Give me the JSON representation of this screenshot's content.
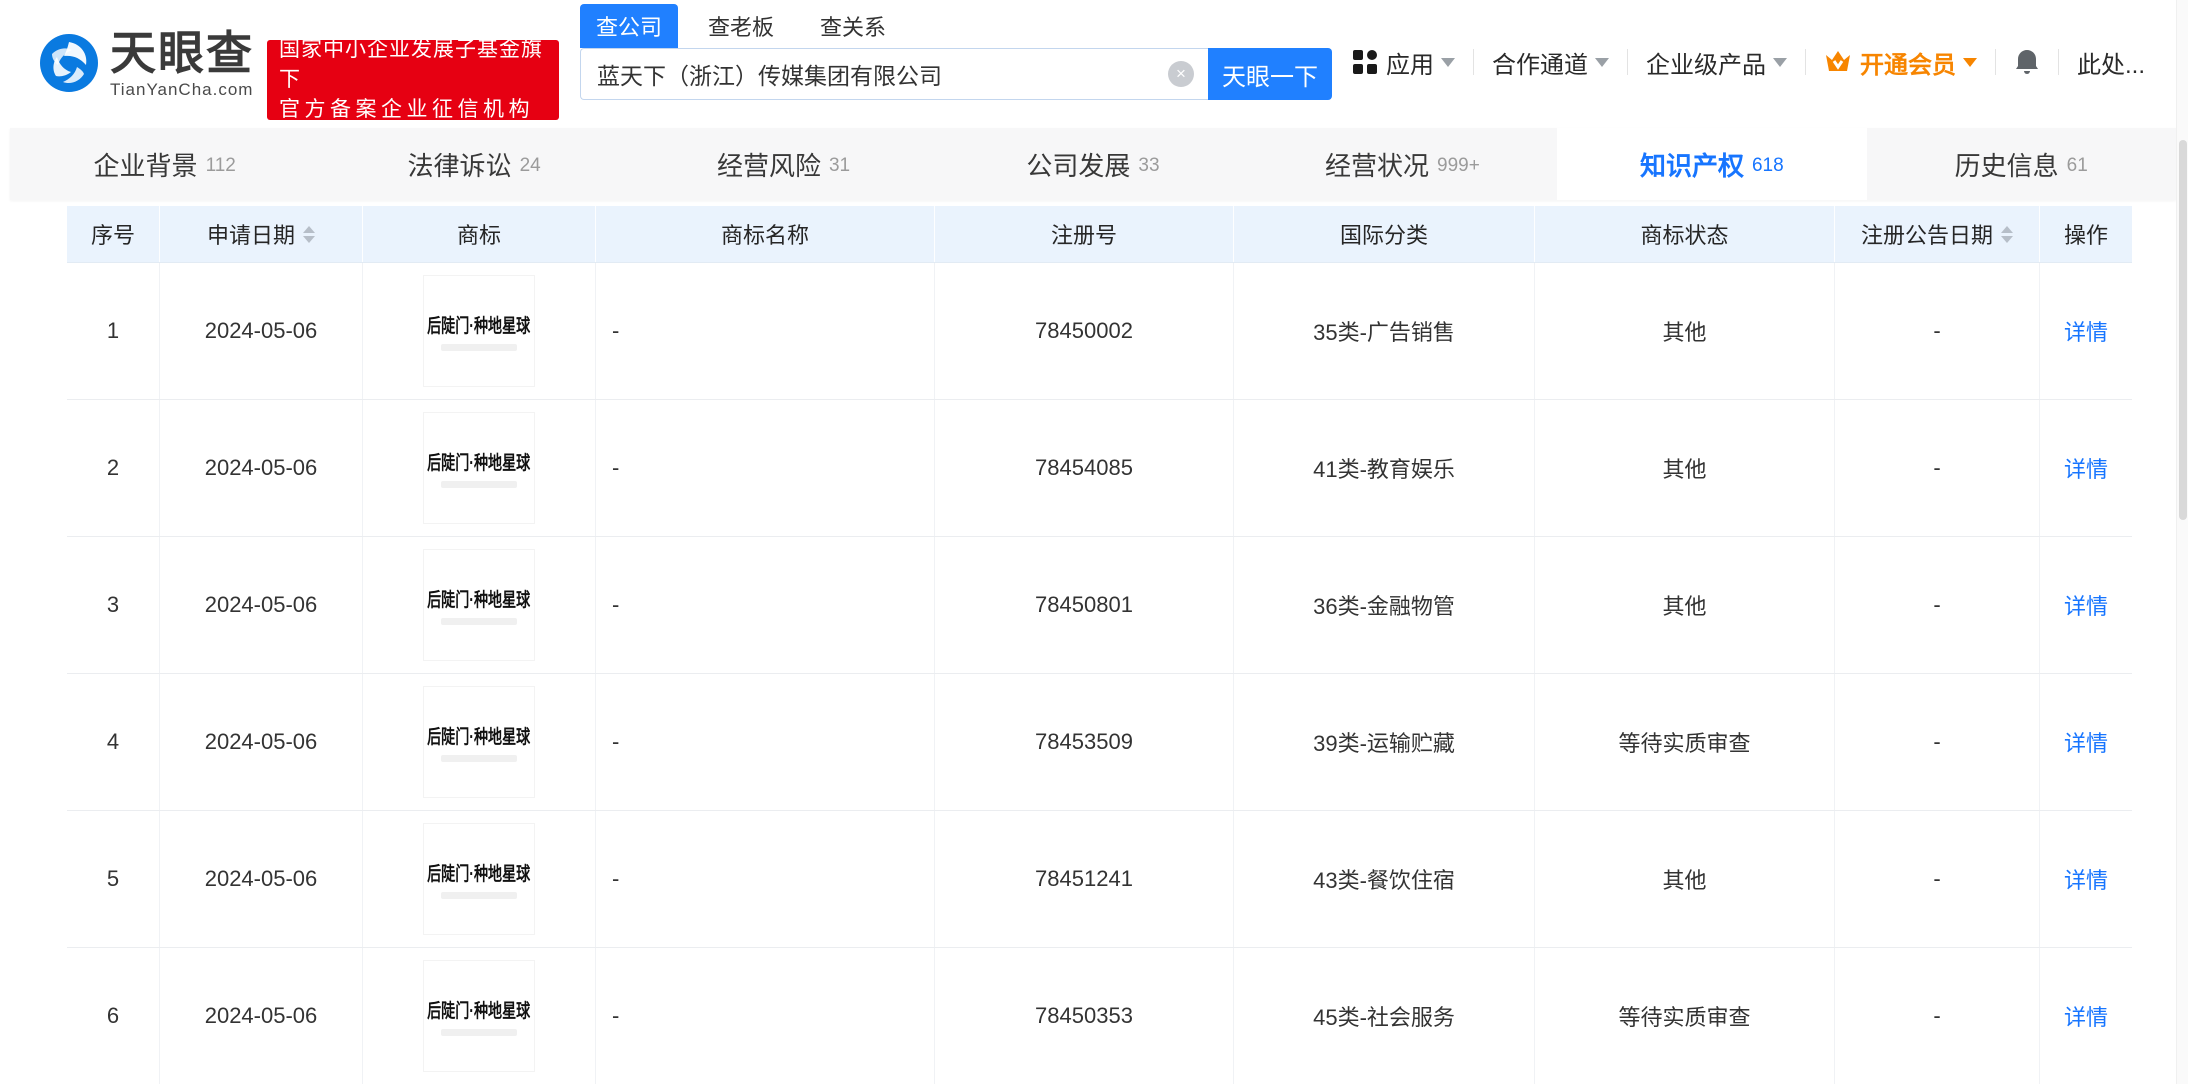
{
  "header": {
    "logo": {
      "title": "天眼查",
      "domain": "TianYanCha.com"
    },
    "badge": {
      "line1": "国家中小企业发展子基金旗下",
      "line2": "官方备案企业征信机构"
    },
    "search": {
      "tabs": [
        {
          "label": "查公司",
          "active": true
        },
        {
          "label": "查老板",
          "active": false
        },
        {
          "label": "查关系",
          "active": false
        }
      ],
      "value": "蓝天下（浙江）传媒集团有限公司",
      "clear_icon": "×",
      "button_label": "天眼一下"
    },
    "nav": {
      "apps": "应用",
      "partner": "合作通道",
      "enterprise": "企业级产品",
      "member": "开通会员",
      "user": "此处..."
    }
  },
  "section_tabs": [
    {
      "label": "企业背景",
      "count": "112",
      "active": false
    },
    {
      "label": "法律诉讼",
      "count": "24",
      "active": false
    },
    {
      "label": "经营风险",
      "count": "31",
      "active": false
    },
    {
      "label": "公司发展",
      "count": "33",
      "active": false
    },
    {
      "label": "经营状况",
      "count": "999+",
      "active": false
    },
    {
      "label": "知识产权",
      "count": "618",
      "active": true
    },
    {
      "label": "历史信息",
      "count": "61",
      "active": false
    }
  ],
  "table": {
    "columns": [
      "序号",
      "申请日期",
      "商标",
      "商标名称",
      "注册号",
      "国际分类",
      "商标状态",
      "注册公告日期",
      "操作"
    ],
    "trademark_text": "后陡门·种地星球",
    "detail_label": "详情",
    "rows": [
      {
        "index": "1",
        "apply_date": "2024-05-06",
        "name": "-",
        "reg_no": "78450002",
        "intl_class": "35类-广告销售",
        "status": "其他",
        "announce_date": "-"
      },
      {
        "index": "2",
        "apply_date": "2024-05-06",
        "name": "-",
        "reg_no": "78454085",
        "intl_class": "41类-教育娱乐",
        "status": "其他",
        "announce_date": "-"
      },
      {
        "index": "3",
        "apply_date": "2024-05-06",
        "name": "-",
        "reg_no": "78450801",
        "intl_class": "36类-金融物管",
        "status": "其他",
        "announce_date": "-"
      },
      {
        "index": "4",
        "apply_date": "2024-05-06",
        "name": "-",
        "reg_no": "78453509",
        "intl_class": "39类-运输贮藏",
        "status": "等待实质审查",
        "announce_date": "-"
      },
      {
        "index": "5",
        "apply_date": "2024-05-06",
        "name": "-",
        "reg_no": "78451241",
        "intl_class": "43类-餐饮住宿",
        "status": "其他",
        "announce_date": "-"
      },
      {
        "index": "6",
        "apply_date": "2024-05-06",
        "name": "-",
        "reg_no": "78450353",
        "intl_class": "45类-社会服务",
        "status": "等待实质审查",
        "announce_date": "-"
      }
    ]
  },
  "colors": {
    "brand_blue": "#2080ff",
    "link_blue": "#1775ff",
    "badge_red": "#e60012",
    "member_orange": "#f78500",
    "table_header_bg": "#eaf3fd",
    "tabbar_bg": "#f7f7f8"
  }
}
